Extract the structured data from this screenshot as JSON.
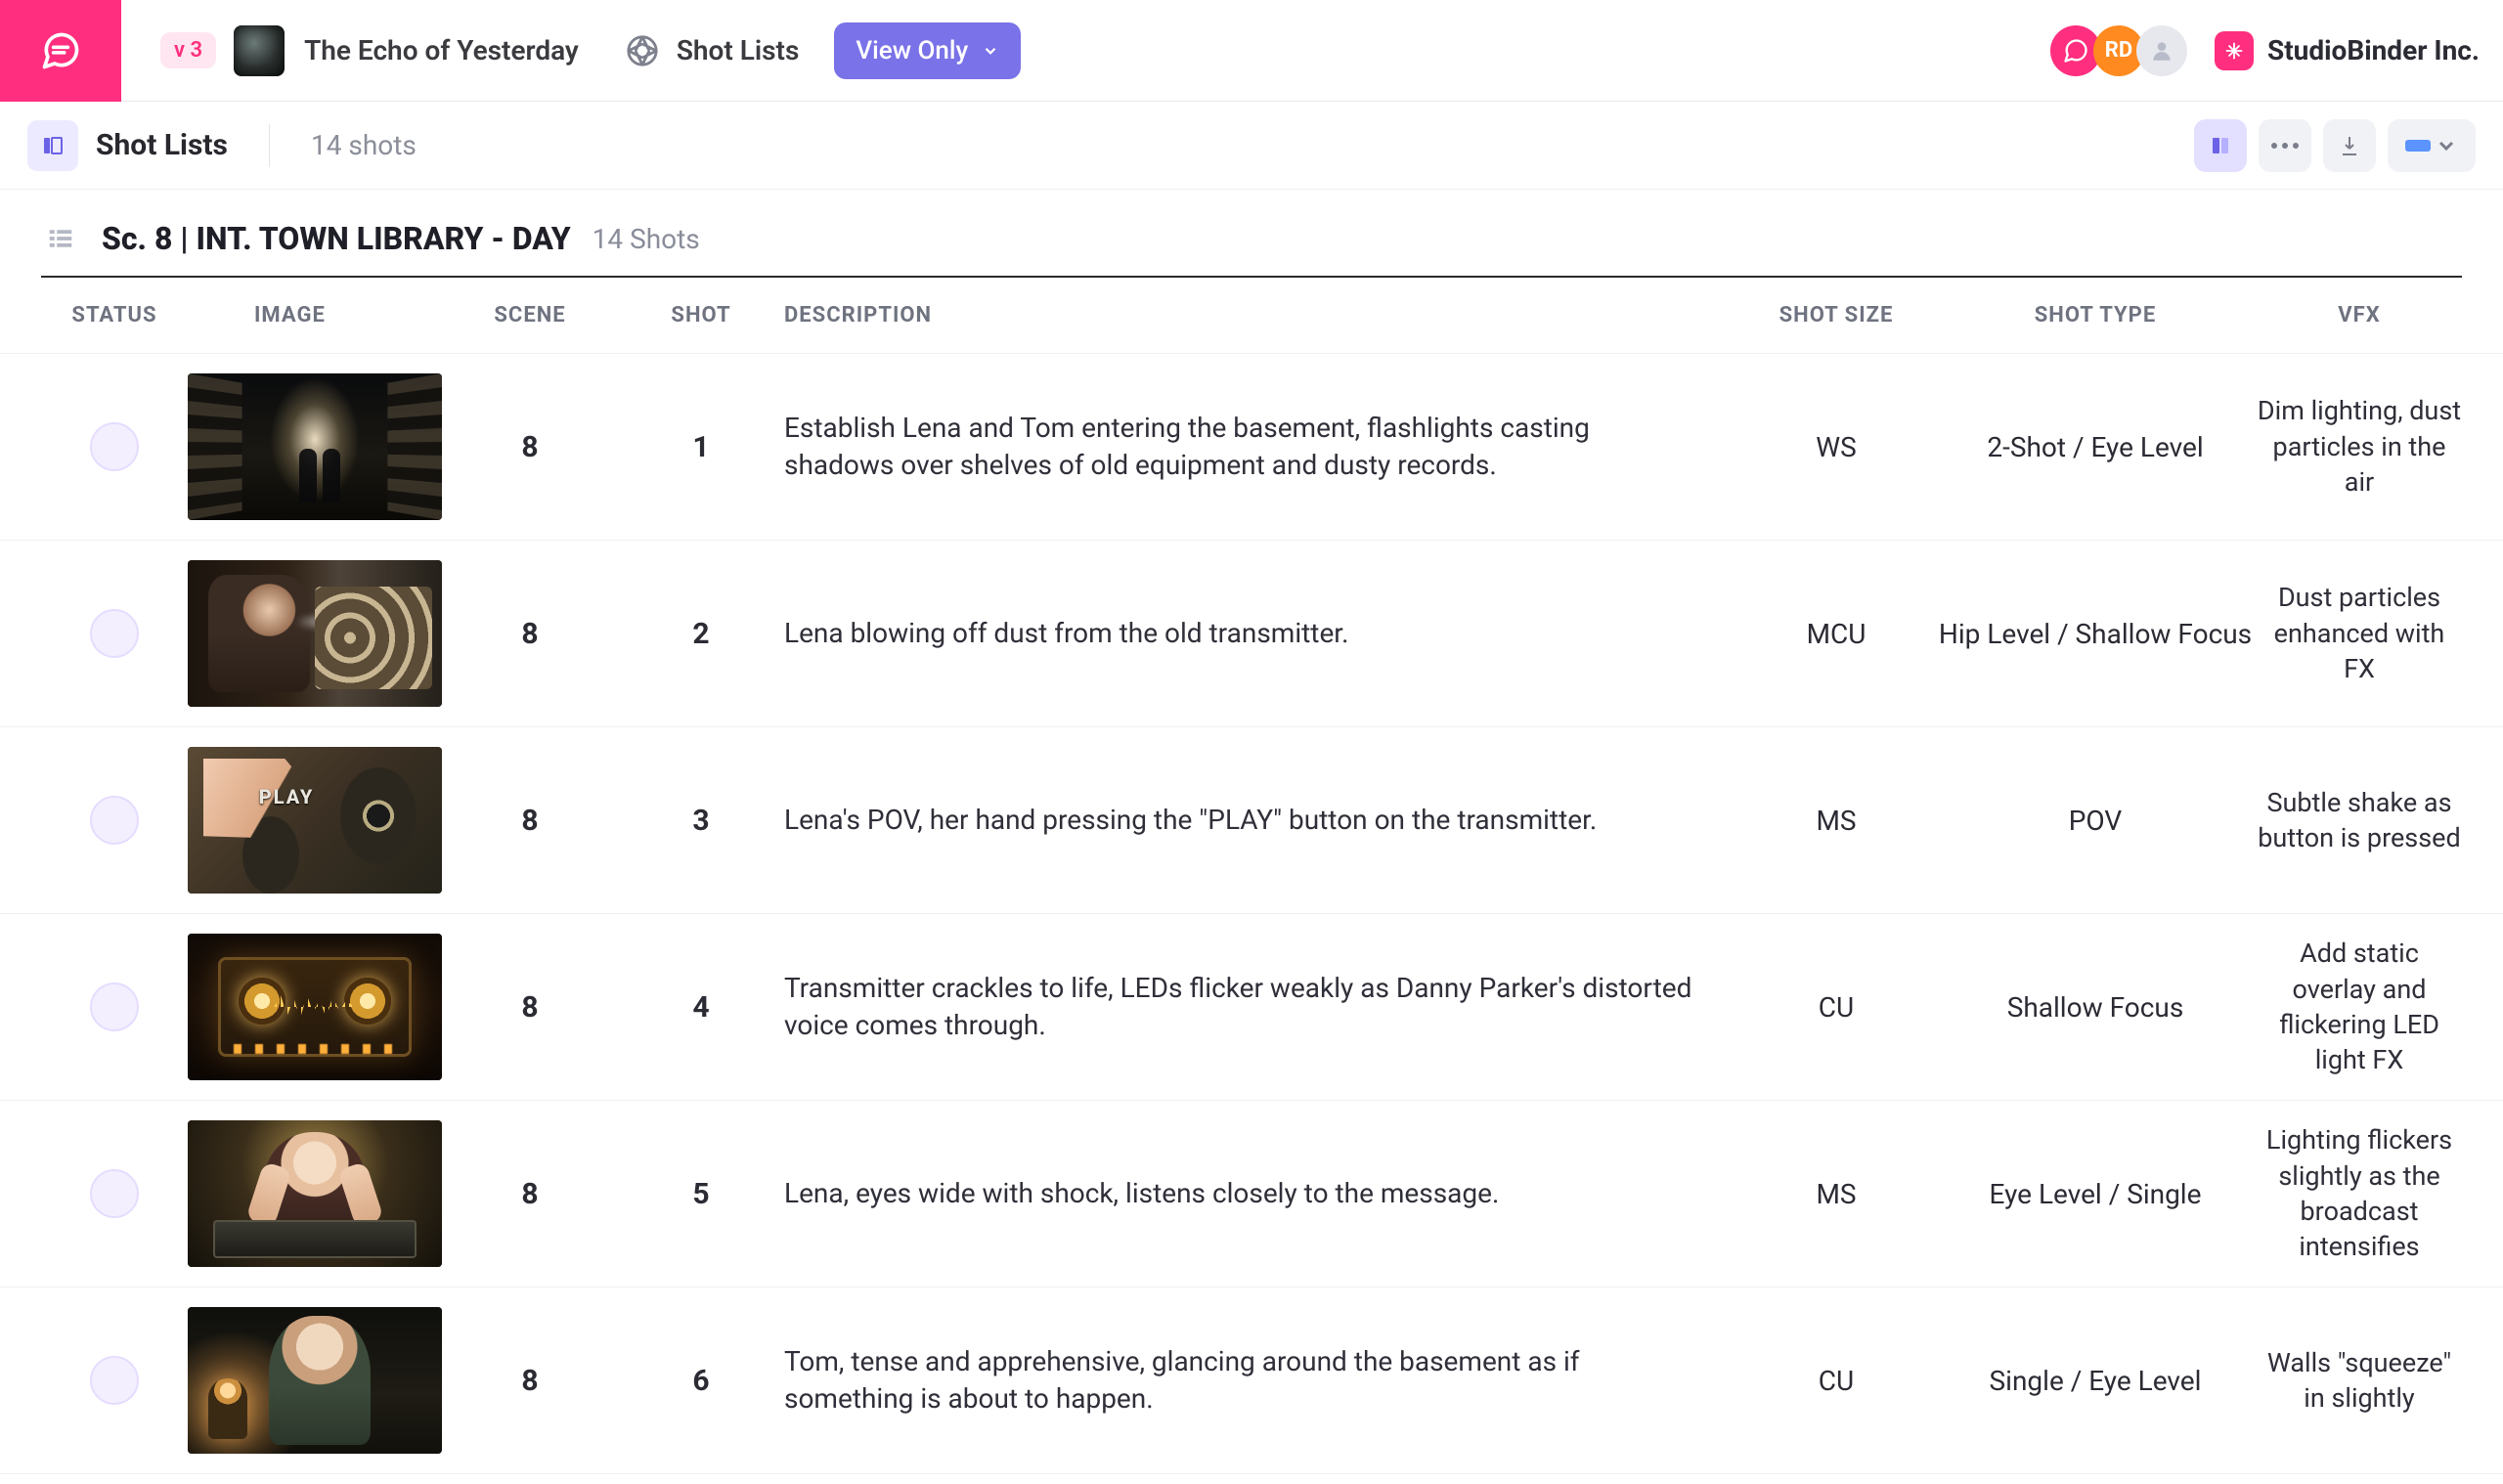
{
  "header": {
    "version": "v 3",
    "project_title": "The Echo of Yesterday",
    "section": "Shot Lists",
    "view_mode": "View Only",
    "avatar_initials": "RD",
    "brand": "StudioBinder Inc."
  },
  "subbar": {
    "title": "Shot Lists",
    "count": "14 shots"
  },
  "scene": {
    "title": "Sc. 8 | INT. TOWN LIBRARY - DAY",
    "count": "14 Shots"
  },
  "columns": {
    "status": "STATUS",
    "image": "IMAGE",
    "scene": "SCENE",
    "shot": "SHOT",
    "description": "DESCRIPTION",
    "shot_size": "SHOT SIZE",
    "shot_type": "SHOT TYPE",
    "vfx": "VFX"
  },
  "rows": [
    {
      "scene": "8",
      "shot": "1",
      "description": "Establish Lena and Tom entering the basement, flashlights casting shadows over shelves of old equipment and dusty records.",
      "shot_size": "WS",
      "shot_type": "2-Shot / Eye Level",
      "vfx": "Dim lighting, dust particles in the air"
    },
    {
      "scene": "8",
      "shot": "2",
      "description": "Lena blowing off dust from the old transmitter.",
      "shot_size": "MCU",
      "shot_type": "Hip Level / Shallow Focus",
      "vfx": "Dust particles enhanced with FX"
    },
    {
      "scene": "8",
      "shot": "3",
      "description": "Lena's POV, her hand pressing the \"PLAY\" button on the transmitter.",
      "shot_size": "MS",
      "shot_type": "POV",
      "vfx": "Subtle shake as button is pressed"
    },
    {
      "scene": "8",
      "shot": "4",
      "description": "Transmitter crackles to life, LEDs flicker weakly as Danny Parker's distorted voice comes through.",
      "shot_size": "CU",
      "shot_type": "Shallow Focus",
      "vfx": "Add static overlay and flickering LED light FX"
    },
    {
      "scene": "8",
      "shot": "5",
      "description": "Lena, eyes wide with shock, listens closely to the message.",
      "shot_size": "MS",
      "shot_type": "Eye Level / Single",
      "vfx": "Lighting flickers slightly as the broadcast intensifies"
    },
    {
      "scene": "8",
      "shot": "6",
      "description": "Tom, tense and apprehensive, glancing around the basement as if something is about to happen.",
      "shot_size": "CU",
      "shot_type": "Single / Eye Level",
      "vfx": "Walls \"squeeze\" in slightly"
    }
  ]
}
